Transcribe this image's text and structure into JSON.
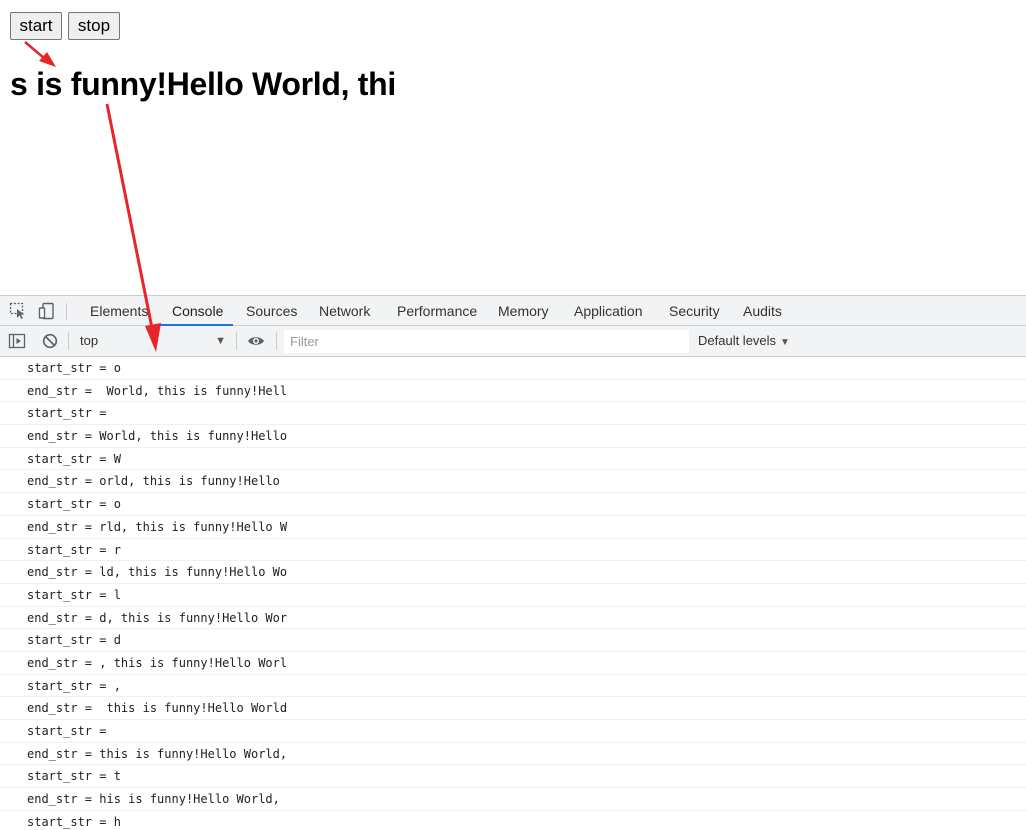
{
  "page": {
    "start_label": "start",
    "stop_label": "stop",
    "marquee_text": "s is funny!Hello World, thi"
  },
  "devtools": {
    "tabs": [
      "Elements",
      "Console",
      "Sources",
      "Network",
      "Performance",
      "Memory",
      "Application",
      "Security",
      "Audits"
    ],
    "active_tab": "Console",
    "context": "top",
    "filter_placeholder": "Filter",
    "levels_label": "Default levels"
  },
  "console": {
    "lines": [
      "start_str = o",
      "end_str =  World, this is funny!Hell",
      "start_str =  ",
      "end_str = World, this is funny!Hello",
      "start_str = W",
      "end_str = orld, this is funny!Hello",
      "start_str = o",
      "end_str = rld, this is funny!Hello W",
      "start_str = r",
      "end_str = ld, this is funny!Hello Wo",
      "start_str = l",
      "end_str = d, this is funny!Hello Wor",
      "start_str = d",
      "end_str = , this is funny!Hello Worl",
      "start_str = ,",
      "end_str =  this is funny!Hello World",
      "start_str =  ",
      "end_str = this is funny!Hello World,",
      "start_str = t",
      "end_str = his is funny!Hello World,",
      "start_str = h"
    ]
  },
  "colors": {
    "accent": "#1a73e8",
    "annotation_arrow": "#e8262a"
  }
}
